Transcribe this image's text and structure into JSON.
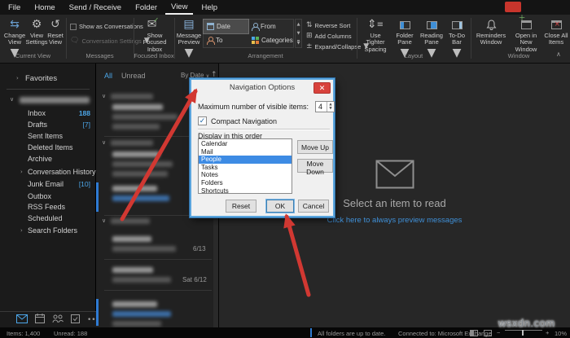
{
  "menu_bar": {
    "tabs": [
      "File",
      "Home",
      "Send / Receive",
      "Folder",
      "View",
      "Help"
    ],
    "active": "View"
  },
  "ribbon": {
    "current_view": {
      "group_label": "Current View",
      "change_view": "Change View",
      "view_settings": "View Settings",
      "reset_view": "Reset View"
    },
    "messages": {
      "group_label": "Messages",
      "show_as_conversations": "Show as Conversations",
      "conversation_settings": "Conversation Settings"
    },
    "focused_inbox": {
      "group_label": "Focused Inbox",
      "show_focused_inbox": "Show Focused Inbox"
    },
    "arrangement": {
      "group_label": "Arrangement",
      "message_preview": "Message Preview",
      "gallery": [
        "Date",
        "From",
        "To",
        "Categories"
      ],
      "selected": "Date",
      "reverse_sort": "Reverse Sort",
      "add_columns": "Add Columns",
      "expand_collapse": "Expand/Collapse"
    },
    "layout": {
      "group_label": "Layout",
      "use_tighter_spacing": "Use Tighter Spacing",
      "folder_pane": "Folder Pane",
      "reading_pane": "Reading Pane",
      "todo_bar": "To-Do Bar"
    },
    "window": {
      "group_label": "Window",
      "reminders_window": "Reminders Window",
      "open_in_new_window": "Open in New Window",
      "close_all_items": "Close All Items"
    }
  },
  "folder_pane": {
    "favorites_label": "Favorites",
    "folders": [
      {
        "name": "Inbox",
        "count": "188"
      },
      {
        "name": "Drafts",
        "count": "[7]"
      },
      {
        "name": "Sent Items",
        "count": ""
      },
      {
        "name": "Deleted Items",
        "count": ""
      },
      {
        "name": "Archive",
        "count": ""
      },
      {
        "name": "Conversation History",
        "count": ""
      },
      {
        "name": "Junk Email",
        "count": "[10]"
      },
      {
        "name": "Outbox",
        "count": ""
      },
      {
        "name": "RSS Feeds",
        "count": ""
      },
      {
        "name": "Scheduled",
        "count": ""
      },
      {
        "name": "Search Folders",
        "count": ""
      }
    ]
  },
  "message_list": {
    "tab_all": "All",
    "tab_unread": "Unread",
    "sort": "By Date",
    "dates": [
      "6/13",
      "Sat 6/12"
    ]
  },
  "reading_pane": {
    "empty_title": "Select an item to read",
    "empty_link": "Click here to always preview messages"
  },
  "dialog": {
    "title": "Navigation Options",
    "max_items_label": "Maximum number of visible items:",
    "max_items_value": "4",
    "compact_label": "Compact Navigation",
    "order_label": "Display in this order",
    "items": [
      "Calendar",
      "Mail",
      "People",
      "Tasks",
      "Notes",
      "Folders",
      "Shortcuts"
    ],
    "selected_item": "People",
    "move_up": "Move Up",
    "move_down": "Move Down",
    "reset": "Reset",
    "ok": "OK",
    "cancel": "Cancel"
  },
  "status_bar": {
    "items_label": "Items: 1,400",
    "unread_label": "Unread: 188",
    "sync_status": "All folders are up to date.",
    "connection_status": "Connected to: Microsoft Exchange",
    "zoom_level": "10%"
  },
  "watermark": "wsxdn.com",
  "colors": {
    "accent": "#4ca6e8",
    "selection": "#3d8be4",
    "dialog_border": "#5aa5dd",
    "arrow": "#d13832"
  }
}
